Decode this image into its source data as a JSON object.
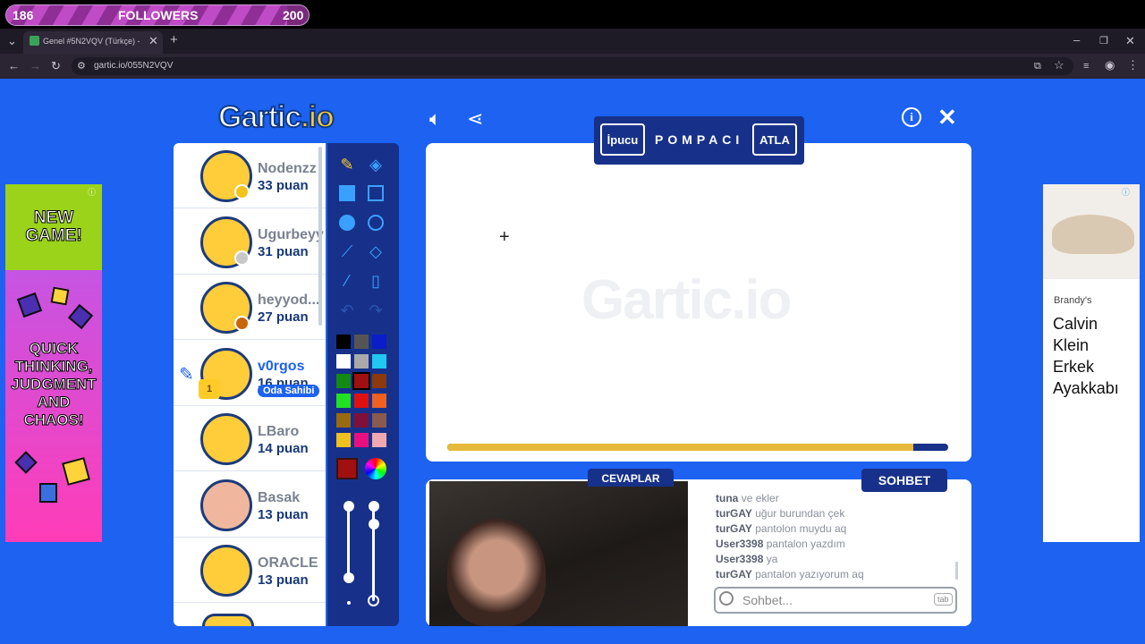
{
  "followers": {
    "current": "186",
    "label": "FOLLOWERS",
    "goal": "200",
    "progress": 0.93
  },
  "browser": {
    "tab_title": "Genel #5N2VQV (Türkçe) - Gar",
    "url": "gartic.io/055N2VQV"
  },
  "game": {
    "logo": "Gartic.io",
    "hint_label": "İpucu",
    "word": "POMPACI",
    "skip_label": "ATLA",
    "watermark": "Gartic.io",
    "timer_progress": 0.93,
    "host_badge": "Oda Sahibi",
    "trophy_rank": "1"
  },
  "players": [
    {
      "name": "Nodenzz",
      "points": "33 puan",
      "dot": "#f2c318"
    },
    {
      "name": "Ugurbeyy",
      "points": "31 puan",
      "dot": "#c8c8c8"
    },
    {
      "name": "heyyod...",
      "points": "27 puan",
      "dot": "#c9650a"
    },
    {
      "name": "v0rgos",
      "points": "16 puan",
      "dot": ""
    },
    {
      "name": "LBaro",
      "points": "14 puan",
      "dot": ""
    },
    {
      "name": "Basak",
      "points": "13 puan",
      "dot": ""
    },
    {
      "name": "ORACLE",
      "points": "13 puan",
      "dot": ""
    }
  ],
  "palette": [
    "#000000",
    "#555555",
    "#0a1dc8",
    "#ffffff",
    "#a9a9a9",
    "#20c8f0",
    "#138a13",
    "#a01010",
    "#8a3a0c",
    "#22e022",
    "#e01010",
    "#f06020",
    "#9a6a10",
    "#80103a",
    "#8a5a50",
    "#f0c020",
    "#e81080",
    "#f0a8b0"
  ],
  "selected_color": "#a01010",
  "chat": {
    "tab_answers": "CEVAPLAR",
    "tab_chat": "SOHBET",
    "placeholder": "Sohbet...",
    "tab_key": "tab",
    "messages": [
      {
        "user": "tuna",
        "text": "ve ekler"
      },
      {
        "user": "turGAY",
        "text": "uğur burundan çek"
      },
      {
        "user": "turGAY",
        "text": "pantolon muydu aq"
      },
      {
        "user": "User3398",
        "text": "pantalon yazdım"
      },
      {
        "user": "User3398",
        "text": "ya"
      },
      {
        "user": "turGAY",
        "text": "pantalon yazıyorum aq"
      }
    ]
  },
  "ads": {
    "left": [
      "NEW GAME!",
      "QUICK THINKING, JUDGMENT AND CHAOS!"
    ],
    "right_brand": "Brandy's",
    "right_title": "Calvin Klein Erkek Ayakkabı"
  }
}
